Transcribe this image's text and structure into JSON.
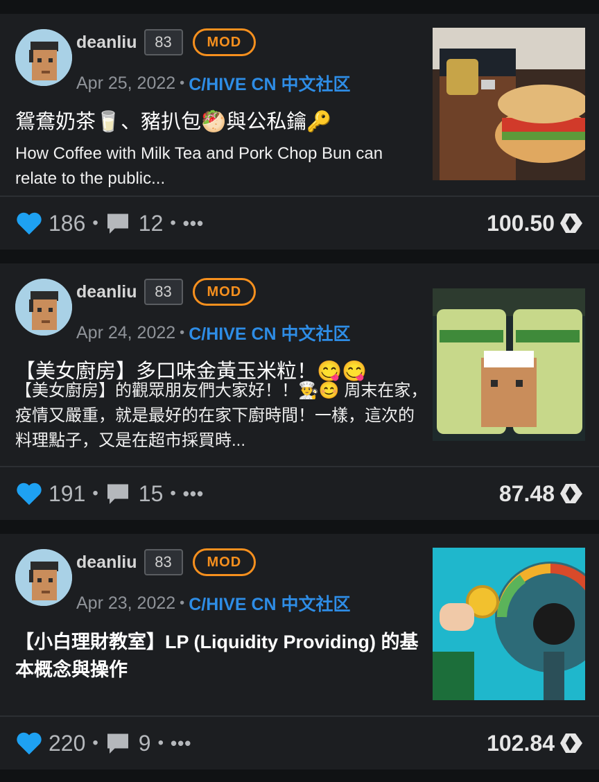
{
  "colors": {
    "background": "#101214",
    "card": "#1c1e21",
    "accent_blue": "#2e8de6",
    "mod_orange": "#f7901e",
    "like_blue": "#1ea1f2"
  },
  "posts": [
    {
      "author": "deanliu",
      "reputation": "83",
      "badge": "MOD",
      "date": "Apr 25, 2022",
      "separator": "•",
      "community": "C/HIVE CN 中文社区",
      "title": "鴛鴦奶茶🥛、豬扒包🥙與公私鑰🔑",
      "excerpt": "How Coffee with Milk Tea and Pork Chop Bun can relate to the public...",
      "likes": "186",
      "comments": "12",
      "more": "•••",
      "payout": "100.50",
      "thumbnail_icon": "milk-tea-bun-photo"
    },
    {
      "author": "deanliu",
      "reputation": "83",
      "badge": "MOD",
      "date": "Apr 24, 2022",
      "separator": "•",
      "community": "C/HIVE CN 中文社区",
      "title": "【美女廚房】多口味金黃玉米粒！😋😋",
      "excerpt": "【美女廚房】的觀眾朋友們大家好！！👨‍🍳😊 周末在家，疫情又嚴重，就是最好的在家下廚時間！一樣，這次的料理點子，又是在超市採買時...",
      "likes": "191",
      "comments": "15",
      "more": "•••",
      "payout": "87.48",
      "thumbnail_icon": "corn-photo"
    },
    {
      "author": "deanliu",
      "reputation": "83",
      "badge": "MOD",
      "date": "Apr 23, 2022",
      "separator": "•",
      "community": "C/HIVE CN 中文社区",
      "title": "【小白理財教室】LP (Liquidity Providing) 的基本概念與操作",
      "excerpt": "",
      "likes": "220",
      "comments": "9",
      "more": "•••",
      "payout": "102.84",
      "thumbnail_icon": "risk-meter-illustration"
    }
  ]
}
